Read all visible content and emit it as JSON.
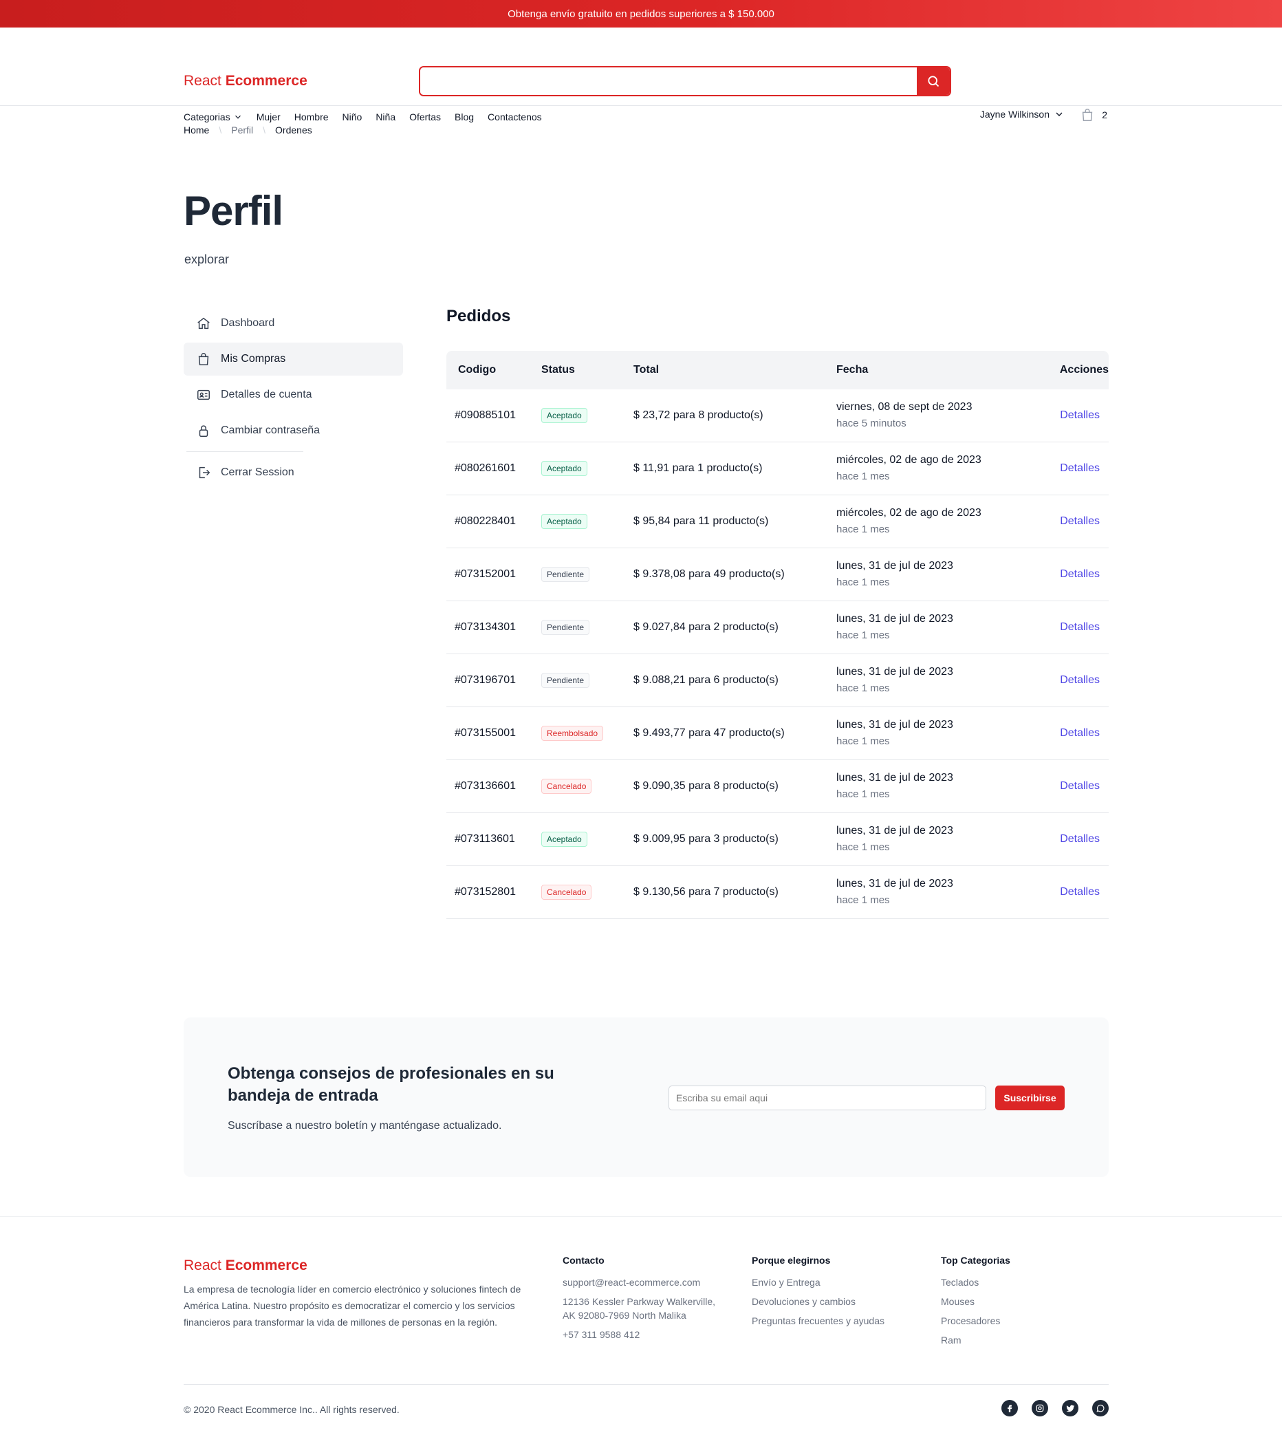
{
  "promo": {
    "text": "Obtenga envío gratuito en pedidos superiores a $ 150.000"
  },
  "brand": {
    "part1": "React ",
    "part2": "Ecommerce"
  },
  "search": {
    "value": "",
    "placeholder": ""
  },
  "nav": {
    "items": [
      "Categorias",
      "Mujer",
      "Hombre",
      "Niño",
      "Niña",
      "Ofertas",
      "Blog",
      "Contactenos"
    ]
  },
  "user": {
    "name": "Jayne Wilkinson"
  },
  "cart": {
    "count": "2"
  },
  "breadcrumb": {
    "items": [
      "Home",
      "Perfil",
      "Ordenes"
    ]
  },
  "page": {
    "title": "Perfil",
    "subtitle": "explorar"
  },
  "sidebar": {
    "items": [
      {
        "label": "Dashboard",
        "icon": "home-icon"
      },
      {
        "label": "Mis Compras",
        "icon": "shopping-bag-icon",
        "active": true
      },
      {
        "label": "Detalles de cuenta",
        "icon": "id-card-icon"
      },
      {
        "label": "Cambiar contraseña",
        "icon": "lock-icon"
      },
      {
        "label": "Cerrar Session",
        "icon": "logout-icon"
      }
    ]
  },
  "orders": {
    "title": "Pedidos",
    "columns": [
      "Codigo",
      "Status",
      "Total",
      "Fecha",
      "Acciones"
    ],
    "rows": [
      {
        "code": "#090885101",
        "status": "Aceptado",
        "kind": "green",
        "amount": "$ 23,72",
        "qty": "para 8 producto(s)",
        "date": "viernes, 08 de sept de 2023",
        "ago": "hace 5 minutos",
        "action": "Detalles"
      },
      {
        "code": "#080261601",
        "status": "Aceptado",
        "kind": "green",
        "amount": "$ 11,91",
        "qty": "para 1 producto(s)",
        "date": "miércoles, 02 de ago de 2023",
        "ago": "hace 1 mes",
        "action": "Detalles"
      },
      {
        "code": "#080228401",
        "status": "Aceptado",
        "kind": "green",
        "amount": "$ 95,84",
        "qty": "para 11 producto(s)",
        "date": "miércoles, 02 de ago de 2023",
        "ago": "hace 1 mes",
        "action": "Detalles"
      },
      {
        "code": "#073152001",
        "status": "Pendiente",
        "kind": "gray",
        "amount": "$ 9.378,08",
        "qty": "para 49 producto(s)",
        "date": "lunes, 31 de jul de 2023",
        "ago": "hace 1 mes",
        "action": "Detalles"
      },
      {
        "code": "#073134301",
        "status": "Pendiente",
        "kind": "gray",
        "amount": "$ 9.027,84",
        "qty": "para 2 producto(s)",
        "date": "lunes, 31 de jul de 2023",
        "ago": "hace 1 mes",
        "action": "Detalles"
      },
      {
        "code": "#073196701",
        "status": "Pendiente",
        "kind": "gray",
        "amount": "$ 9.088,21",
        "qty": "para 6 producto(s)",
        "date": "lunes, 31 de jul de 2023",
        "ago": "hace 1 mes",
        "action": "Detalles"
      },
      {
        "code": "#073155001",
        "status": "Reembolsado",
        "kind": "red",
        "amount": "$ 9.493,77",
        "qty": "para 47 producto(s)",
        "date": "lunes, 31 de jul de 2023",
        "ago": "hace 1 mes",
        "action": "Detalles"
      },
      {
        "code": "#073136601",
        "status": "Cancelado",
        "kind": "red",
        "amount": "$ 9.090,35",
        "qty": "para 8 producto(s)",
        "date": "lunes, 31 de jul de 2023",
        "ago": "hace 1 mes",
        "action": "Detalles"
      },
      {
        "code": "#073113601",
        "status": "Aceptado",
        "kind": "green",
        "amount": "$ 9.009,95",
        "qty": "para 3 producto(s)",
        "date": "lunes, 31 de jul de 2023",
        "ago": "hace 1 mes",
        "action": "Detalles"
      },
      {
        "code": "#073152801",
        "status": "Cancelado",
        "kind": "red",
        "amount": "$ 9.130,56",
        "qty": "para 7 producto(s)",
        "date": "lunes, 31 de jul de 2023",
        "ago": "hace 1 mes",
        "action": "Detalles"
      }
    ]
  },
  "newsletter": {
    "title": "Obtenga consejos de profesionales en su bandeja de entrada",
    "subtitle": "Suscríbase a nuestro boletín y manténgase actualizado.",
    "placeholder": "Escriba su email aqui",
    "button": "Suscribirse"
  },
  "footer": {
    "description": "La empresa de tecnología líder en comercio electrónico y soluciones fintech de América Latina. Nuestro propósito es democratizar el comercio y los servicios financieros para transformar la vida de millones de personas en la región.",
    "contact": {
      "heading": "Contacto",
      "email": "support@react-ecommerce.com",
      "address1": "12136 Kessler Parkway Walkerville,",
      "address2": "AK 92080-7969 North Malika",
      "phone": "+57 311 9588 412"
    },
    "why": {
      "heading": "Porque elegirnos",
      "items": [
        "Envío y Entrega",
        "Devoluciones y cambios",
        "Preguntas frecuentes y ayudas"
      ]
    },
    "top": {
      "heading": "Top Categorias",
      "items": [
        "Teclados",
        "Mouses",
        "Procesadores",
        "Ram"
      ]
    },
    "copyright": "© 2020 React Ecommerce Inc.. All rights reserved.",
    "socials": [
      "facebook-icon",
      "instagram-icon",
      "twitter-icon",
      "whatsapp-icon"
    ]
  },
  "colors": {
    "accent": "#dc2626",
    "link": "#4f46e5"
  }
}
